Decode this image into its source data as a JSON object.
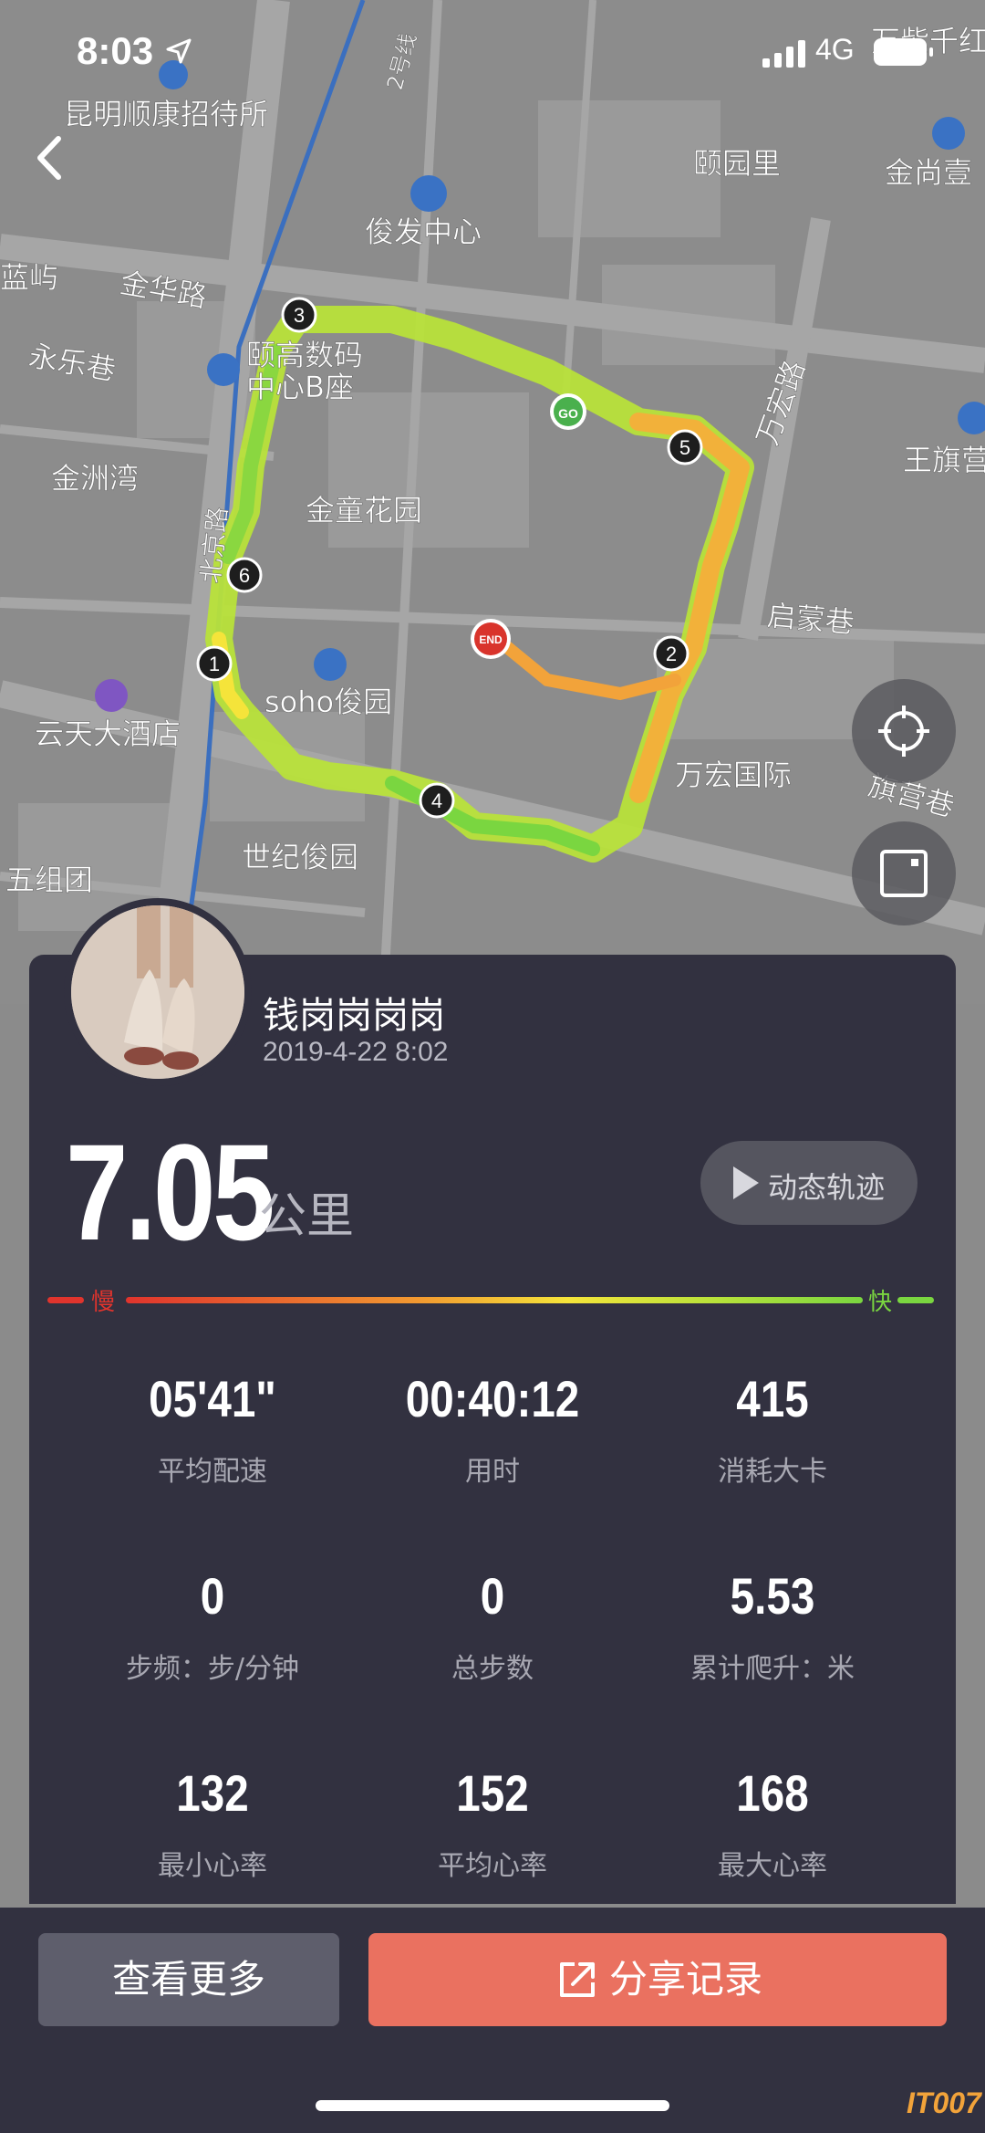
{
  "status": {
    "time": "8:03",
    "network": "4G"
  },
  "map": {
    "labels": [
      "昆明顺康招待所",
      "颐园里",
      "金尚壹",
      "俊发中心",
      "蓝屿",
      "金华路",
      "永乐巷",
      "颐高数码",
      "中心B座",
      "金洲湾",
      "金童花园",
      "北京路",
      "万宏路",
      "王旗营",
      "启蒙巷",
      "soho俊园",
      "云天大酒店",
      "万宏国际",
      "旗营巷",
      "世纪俊园",
      "五组团",
      "2号线",
      "万紫千红"
    ],
    "markers": [
      "1",
      "2",
      "3",
      "4",
      "5",
      "6"
    ],
    "start_label": "GO",
    "end_label": "END",
    "colors": {
      "route_slow": "#e0342d",
      "route_mid": "#f5e43a",
      "route_fast": "#7ad640",
      "metro_line": "#3b6fbf"
    }
  },
  "profile": {
    "name": "钱岗岗岗岗",
    "datetime": "2019-4-22 8:02"
  },
  "summary": {
    "distance": "7.05",
    "unit": "公里",
    "replay_label": "动态轨迹"
  },
  "pace_legend": {
    "slow": "慢",
    "fast": "快"
  },
  "stats": [
    {
      "value": "05'41\"",
      "label": "平均配速"
    },
    {
      "value": "00:40:12",
      "label": "用时"
    },
    {
      "value": "415",
      "label": "消耗大卡"
    },
    {
      "value": "0",
      "label": "步频：步/分钟"
    },
    {
      "value": "0",
      "label": "总步数"
    },
    {
      "value": "5.53",
      "label": "累计爬升：米"
    },
    {
      "value": "132",
      "label": "最小心率"
    },
    {
      "value": "152",
      "label": "平均心率"
    },
    {
      "value": "168",
      "label": "最大心率"
    }
  ],
  "actions": {
    "more": "查看更多",
    "share": "分享记录"
  },
  "watermark": "IT007",
  "icons": {
    "back": "chevron-left-icon",
    "locate": "locate-icon",
    "fullscreen": "expand-icon",
    "replay": "play-icon",
    "share": "share-icon"
  }
}
